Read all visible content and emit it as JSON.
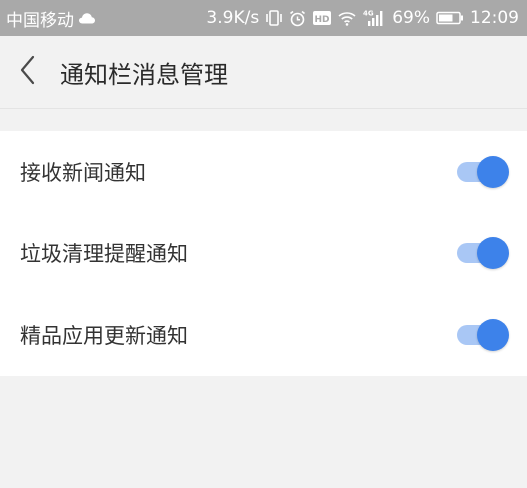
{
  "status_bar": {
    "carrier": "中国移动",
    "cloud_icon": "cloud-icon",
    "speed": "3.9K/s",
    "vibrate_icon": "vibrate-icon",
    "alarm_icon": "alarm-icon",
    "hd_label": "HD",
    "wifi_icon": "wifi-icon",
    "network_label": "4G",
    "signal_icon": "signal-icon",
    "battery": "69%",
    "battery_icon": "battery-icon",
    "time": "12:09"
  },
  "header": {
    "back_icon": "chevron-left-icon",
    "title": "通知栏消息管理"
  },
  "settings": {
    "items": [
      {
        "label": "接收新闻通知",
        "enabled": true
      },
      {
        "label": "垃圾清理提醒通知",
        "enabled": true
      },
      {
        "label": "精品应用更新通知",
        "enabled": true
      }
    ]
  },
  "colors": {
    "status_bar_bg": "#a9a9a9",
    "page_bg": "#f2f2f2",
    "toggle_knob": "#3d82ea",
    "toggle_track": "#a9c7f5"
  }
}
